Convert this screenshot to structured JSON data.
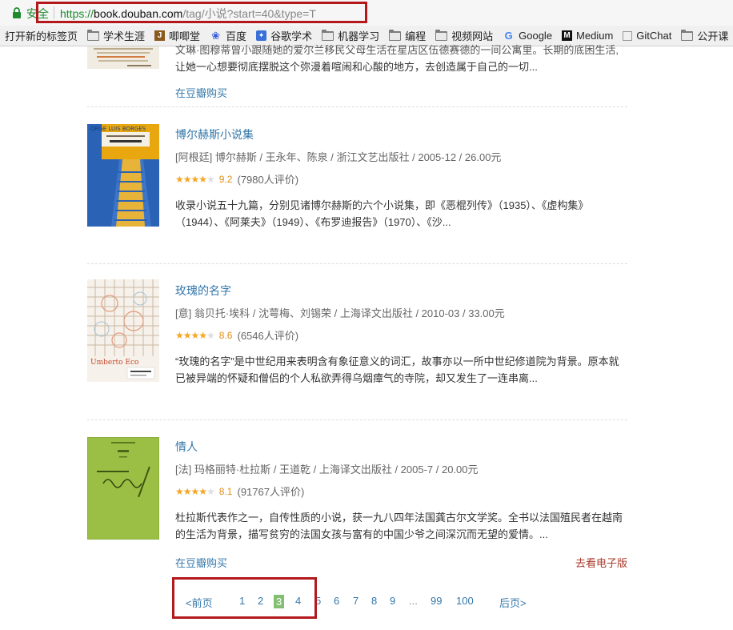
{
  "browser": {
    "secure_label": "安全",
    "url_scheme": "https://",
    "url_host": "book.douban.com",
    "url_path": "/tag/小说?start=40&type=T"
  },
  "bookmarks": [
    {
      "label": "打开新的标签页",
      "icon": "none"
    },
    {
      "label": "学术生涯",
      "icon": "folder-icon"
    },
    {
      "label": "唧唧堂",
      "icon": "jijitang-icon"
    },
    {
      "label": "百度",
      "icon": "baidu-paw-icon"
    },
    {
      "label": "谷歌学术",
      "icon": "scholar-icon"
    },
    {
      "label": "机器学习",
      "icon": "folder-icon"
    },
    {
      "label": "编程",
      "icon": "folder-icon"
    },
    {
      "label": "视频网站",
      "icon": "folder-icon"
    },
    {
      "label": "Google",
      "icon": "google-icon"
    },
    {
      "label": "Medium",
      "icon": "medium-icon"
    },
    {
      "label": "GitChat",
      "icon": "page-icon"
    },
    {
      "label": "公开课",
      "icon": "folder-icon"
    }
  ],
  "prev_entry": {
    "desc_line1": "文琳·图穆蒂曾小跟随她的爱尔兰移民父母生活在星店区伍德赛德的一间公寓里。长期的底困生活,",
    "desc_line2": "让她一心想要彻底摆脱这个弥漫着喧闹和心酸的地方，去创造属于自己的一切...",
    "buy_label": "在豆瓣购买"
  },
  "books": [
    {
      "title": "博尔赫斯小说集",
      "meta": "[阿根廷] 博尔赫斯 / 王永年、陈泉 / 浙江文艺出版社 / 2005-12 / 26.00元",
      "rating": 9.2,
      "score": "9.2",
      "stars": 4.5,
      "votes": "(7980人评价)",
      "desc_line1": "收录小说五十九篇，分别见诸博尔赫斯的六个小说集，即《恶棍列传》（1935）、《虚构集》",
      "desc_line2": "（1944）、《阿莱夫》（1949）、《布罗迪报告》（1970）、《沙..."
    },
    {
      "title": "玫瑰的名字",
      "meta": "[意] 翁贝托·埃科 / 沈萼梅、刘锡荣 / 上海译文出版社 / 2010-03 / 33.00元",
      "rating": 8.6,
      "score": "8.6",
      "stars": 4.5,
      "votes": "(6546人评价)",
      "desc_line1": "“玫瑰的名字”是中世纪用来表明含有象征意义的词汇，故事亦以一所中世纪修道院为背景。原本就",
      "desc_line2": "已被异端的怀疑和僧侣的个人私欲弄得乌烟瘴气的寺院，却又发生了一连串离..."
    },
    {
      "title": "情人",
      "meta": "[法] 玛格丽特·杜拉斯 / 王道乾 / 上海译文出版社 / 2005-7 / 20.00元",
      "rating": 8.1,
      "score": "8.1",
      "stars": 4,
      "votes": "(91767人评价)",
      "desc_line1": "杜拉斯代表作之一，自传性质的小说，获一九八四年法国龚古尔文学奖。全书以法国殖民者在越南",
      "desc_line2": "的生活为背景，描写贫穷的法国女孩与富有的中国少爷之间深沉而无望的爱情。...",
      "buy_label": "在豆瓣购买",
      "ebook_label": "去看电子版"
    }
  ],
  "pagination": {
    "prev": "<前页",
    "pages": [
      "1",
      "2",
      "3",
      "4",
      "5",
      "6",
      "7",
      "8",
      "9"
    ],
    "current": "3",
    "ellipsis": "...",
    "last_pages": [
      "99",
      "100"
    ],
    "next": "后页>"
  },
  "colors": {
    "link": "#3377aa",
    "star": "#f5a623",
    "current_page": "#83bf73",
    "highlight_box": "#b3191b"
  }
}
